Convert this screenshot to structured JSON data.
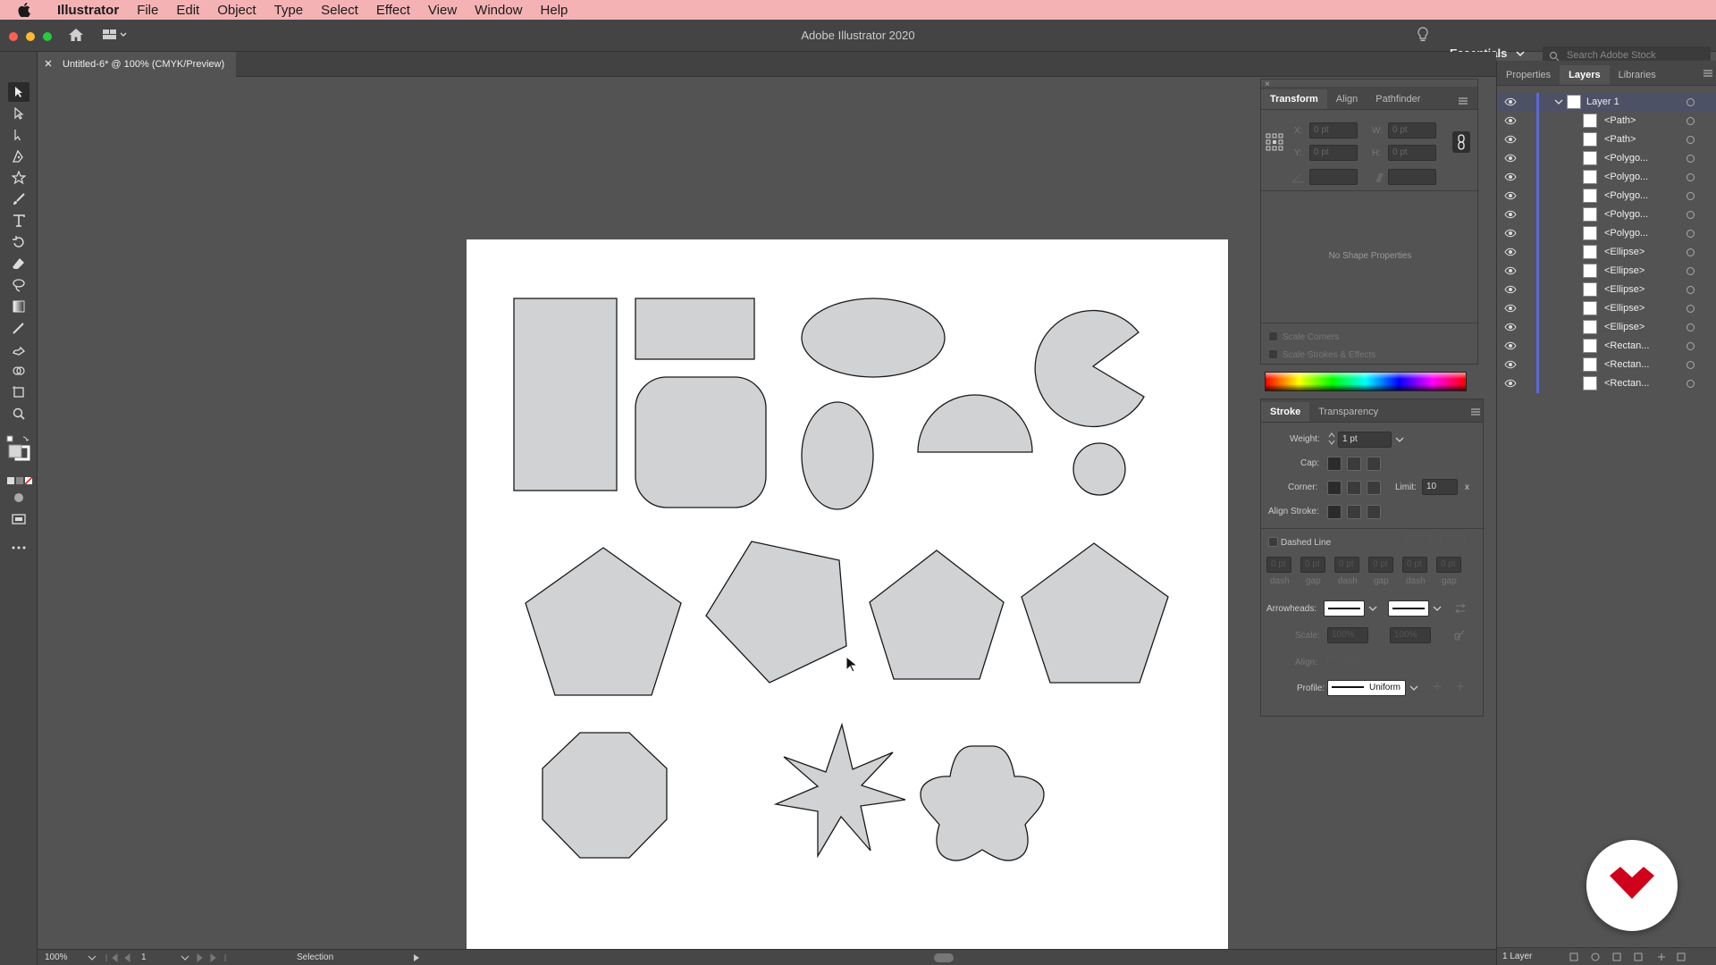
{
  "menubar": {
    "app_name": "Illustrator",
    "items": [
      "File",
      "Edit",
      "Object",
      "Type",
      "Select",
      "Effect",
      "View",
      "Window",
      "Help"
    ]
  },
  "titlebar": {
    "app_title": "Adobe Illustrator 2020",
    "workspace": "Essentials",
    "search_placeholder": "Search Adobe Stock"
  },
  "document": {
    "tab_title": "Untitled-6* @ 100% (CMYK/Preview)"
  },
  "toolbar": {
    "tools": [
      "selection-tool",
      "direct-selection-tool",
      "line-tool",
      "pen-tool",
      "star-tool",
      "paintbrush-tool",
      "type-tool",
      "rotate-tool",
      "eraser-tool",
      "lasso-tool",
      "gradient-tool",
      "eyedropper-tool",
      "shaper-tool",
      "shape-builder-tool",
      "artboard-tool",
      "zoom-tool"
    ]
  },
  "transform_panel": {
    "tabs": [
      "Transform",
      "Align",
      "Pathfinder"
    ],
    "active_tab": "Transform",
    "x_label": "X:",
    "y_label": "Y:",
    "w_label": "W:",
    "h_label": "H:",
    "x_value": "0 pt",
    "y_value": "0 pt",
    "w_value": "0 pt",
    "h_value": "0 pt",
    "no_shape": "No Shape Properties",
    "scale_corners": "Scale Corners",
    "scale_strokes": "Scale Strokes & Effects"
  },
  "stroke_panel": {
    "tabs": [
      "Stroke",
      "Transparency"
    ],
    "active_tab": "Stroke",
    "weight_label": "Weight:",
    "weight_value": "1 pt",
    "cap_label": "Cap:",
    "corner_label": "Corner:",
    "limit_label": "Limit:",
    "limit_value": "10",
    "limit_unit": "x",
    "align_label": "Align Stroke:",
    "dashed_label": "Dashed Line",
    "dash_labels": [
      "dash",
      "gap",
      "dash",
      "gap",
      "dash",
      "gap"
    ],
    "dash_values": [
      "0 pt",
      "0 pt",
      "0 pt",
      "0 pt",
      "0 pt",
      "0 pt"
    ],
    "arrowheads_label": "Arrowheads:",
    "scale_label": "Scale:",
    "scale_values": [
      "100%",
      "100%"
    ],
    "align_arrow_label": "Align:",
    "profile_label": "Profile:",
    "profile_value": "Uniform"
  },
  "layers_panel": {
    "tabs": [
      "Properties",
      "Layers",
      "Libraries"
    ],
    "active_tab": "Layers",
    "layer_name": "Layer 1",
    "items": [
      "<Path>",
      "<Path>",
      "<Polygo...",
      "<Polygo...",
      "<Polygo...",
      "<Polygo...",
      "<Polygo...",
      "<Ellipse>",
      "<Ellipse>",
      "<Ellipse>",
      "<Ellipse>",
      "<Ellipse>",
      "<Rectan...",
      "<Rectan...",
      "<Rectan..."
    ],
    "footer": "1 Layer"
  },
  "statusbar": {
    "zoom": "100%",
    "artboard": "1",
    "tool": "Selection"
  },
  "colors": {
    "menubar": "#f4b2b4",
    "shape_fill": "#d1d2d4",
    "layer_bar": "#5b6ad6",
    "logo_red": "#d0021b"
  }
}
